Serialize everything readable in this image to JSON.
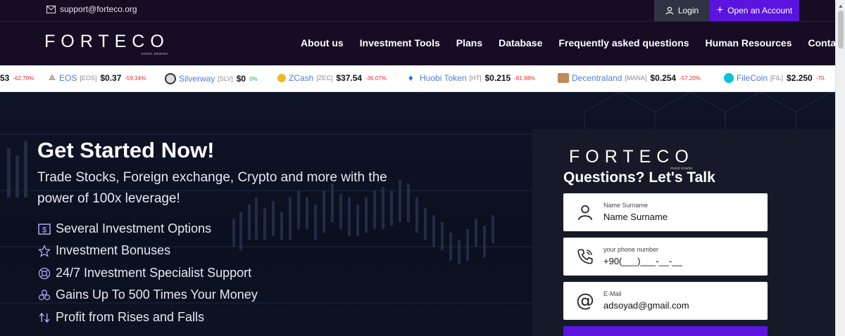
{
  "topbar": {
    "email": "support@forteco.org",
    "login_label": "Login",
    "open_account_label": "Open an Account"
  },
  "brand": {
    "name": "FORTECO",
    "tagline": "invest smarter"
  },
  "nav": {
    "items": [
      "About us",
      "Investment Tools",
      "Plans",
      "Database",
      "Frequently asked questions",
      "Human Resources",
      "Contact"
    ]
  },
  "ticker": {
    "items": [
      {
        "name": "",
        "symbol": "",
        "price": "53",
        "change": "-62.70%",
        "direction": "down",
        "icon": "coin-icon",
        "color": "#222222"
      },
      {
        "name": "EOS",
        "symbol": "[EOS]",
        "price": "$0.37",
        "change": "-59.34%",
        "direction": "down",
        "icon": "eos-icon",
        "color": "#555555"
      },
      {
        "name": "Silverway",
        "symbol": "[SLV]",
        "price": "$0",
        "change": "0%",
        "direction": "up",
        "icon": "silverway-icon",
        "color": "#444444"
      },
      {
        "name": "ZCash",
        "symbol": "[ZEC]",
        "price": "$37.54",
        "change": "-36.07%",
        "direction": "down",
        "icon": "zcash-icon",
        "color": "#f4b728"
      },
      {
        "name": "Huobi Token",
        "symbol": "[HT]",
        "price": "$0.215",
        "change": "-81.98%",
        "direction": "down",
        "icon": "huobi-icon",
        "color": "#2a6be0"
      },
      {
        "name": "Decentraland",
        "symbol": "[MANA]",
        "price": "$0.254",
        "change": "-57.20%",
        "direction": "down",
        "icon": "decentraland-icon",
        "color": "#c08a5a"
      },
      {
        "name": "FileCoin",
        "symbol": "[FIL]",
        "price": "$2.250",
        "change": "-70.",
        "direction": "down",
        "icon": "filecoin-icon",
        "color": "#0ac2d8"
      }
    ]
  },
  "hero": {
    "title": "Get Started Now!",
    "subtitle": "Trade Stocks, Foreign exchange, Crypto and more with the power of 100x leverage!",
    "features": [
      {
        "label": "Several Investment Options",
        "icon": "dollar-icon"
      },
      {
        "label": "Investment Bonuses",
        "icon": "star-icon"
      },
      {
        "label": "24/7 Investment Specialist Support",
        "icon": "support-icon"
      },
      {
        "label": "Gains Up To 500 Times Your Money",
        "icon": "coins-icon"
      },
      {
        "label": "Profit from Rises and Falls",
        "icon": "sort-icon"
      }
    ]
  },
  "form": {
    "title": "Questions? Let's Talk",
    "name_label": "Name Surname",
    "name_value": "Name Surname",
    "phone_label": "your phone number",
    "phone_value": "+90(___)___-__-__",
    "email_label": "E-Mail",
    "email_value": "adsoyad@gmail.com"
  },
  "colors": {
    "accent": "#5b14e0",
    "header_bg": "#160c24",
    "hero_bg": "#0e1427",
    "negative": "#e02a2a",
    "positive": "#1ea84a"
  }
}
